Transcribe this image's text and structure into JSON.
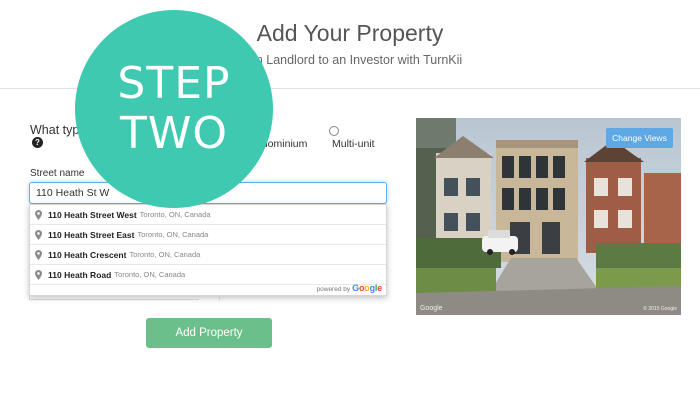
{
  "header": {
    "title": "Add Your Property",
    "subtitle": "from Landlord to an Investor with TurnKii"
  },
  "form": {
    "type_label": "What type",
    "type_options": [
      "ndominium",
      "Multi-unit"
    ],
    "street_label": "Street name",
    "street_value": "110 Heath St W",
    "suggestions": [
      {
        "main": "110 Heath Street West",
        "secondary": "Toronto, ON, Canada"
      },
      {
        "main": "110 Heath Street East",
        "secondary": "Toronto, ON, Canada"
      },
      {
        "main": "110 Heath Crescent",
        "secondary": "Toronto, ON, Canada"
      },
      {
        "main": "110 Heath Road",
        "secondary": "Toronto, ON, Canada"
      }
    ],
    "powered_by": "powered by",
    "google": "Google",
    "submit_label": "Add Property"
  },
  "street_view": {
    "change_views_label": "Change Views",
    "logo": "Google",
    "copyright": "© 2015 Google"
  },
  "overlay": {
    "line1": "STEP",
    "line2": "TWO",
    "color": "#3ec9b0"
  },
  "colors": {
    "button": "#6bbf8a",
    "change_views": "#5fa8e6",
    "input_focus": "#66afe9"
  }
}
